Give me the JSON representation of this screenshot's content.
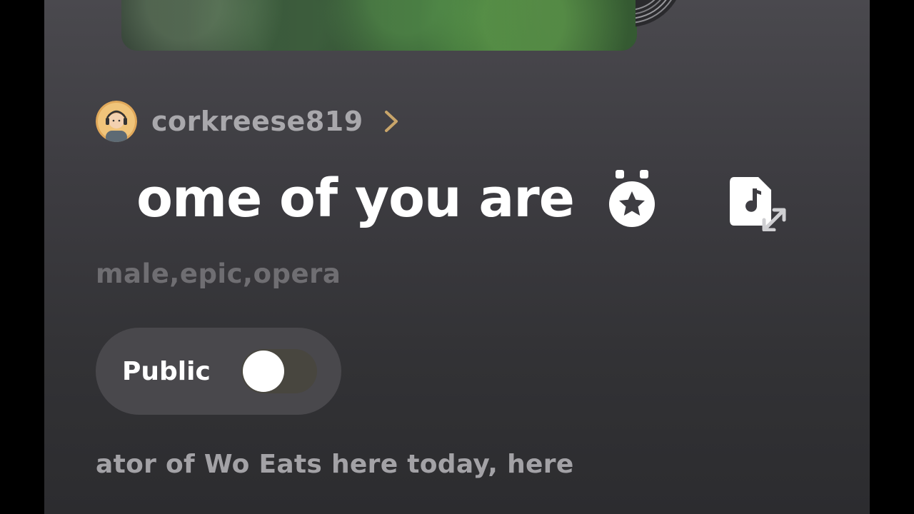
{
  "creator": {
    "username": "corkreese819",
    "avatar_icon": "user-avatar",
    "chevron_icon": "chevron-right-icon",
    "chevron_color": "#c9a56a"
  },
  "song": {
    "title": "ome of you are",
    "tags": "male,epic,opera",
    "description": "ator of Wo Eats here today, here"
  },
  "actions": {
    "award_icon": "award-medal-icon",
    "file_music_icon": "file-music-expand-icon"
  },
  "visibility": {
    "label": "Public",
    "enabled": false
  },
  "colors": {
    "background": "#3d3c41",
    "pill": "#49484c",
    "title": "#ffffff",
    "muted": "#6f6e72"
  }
}
